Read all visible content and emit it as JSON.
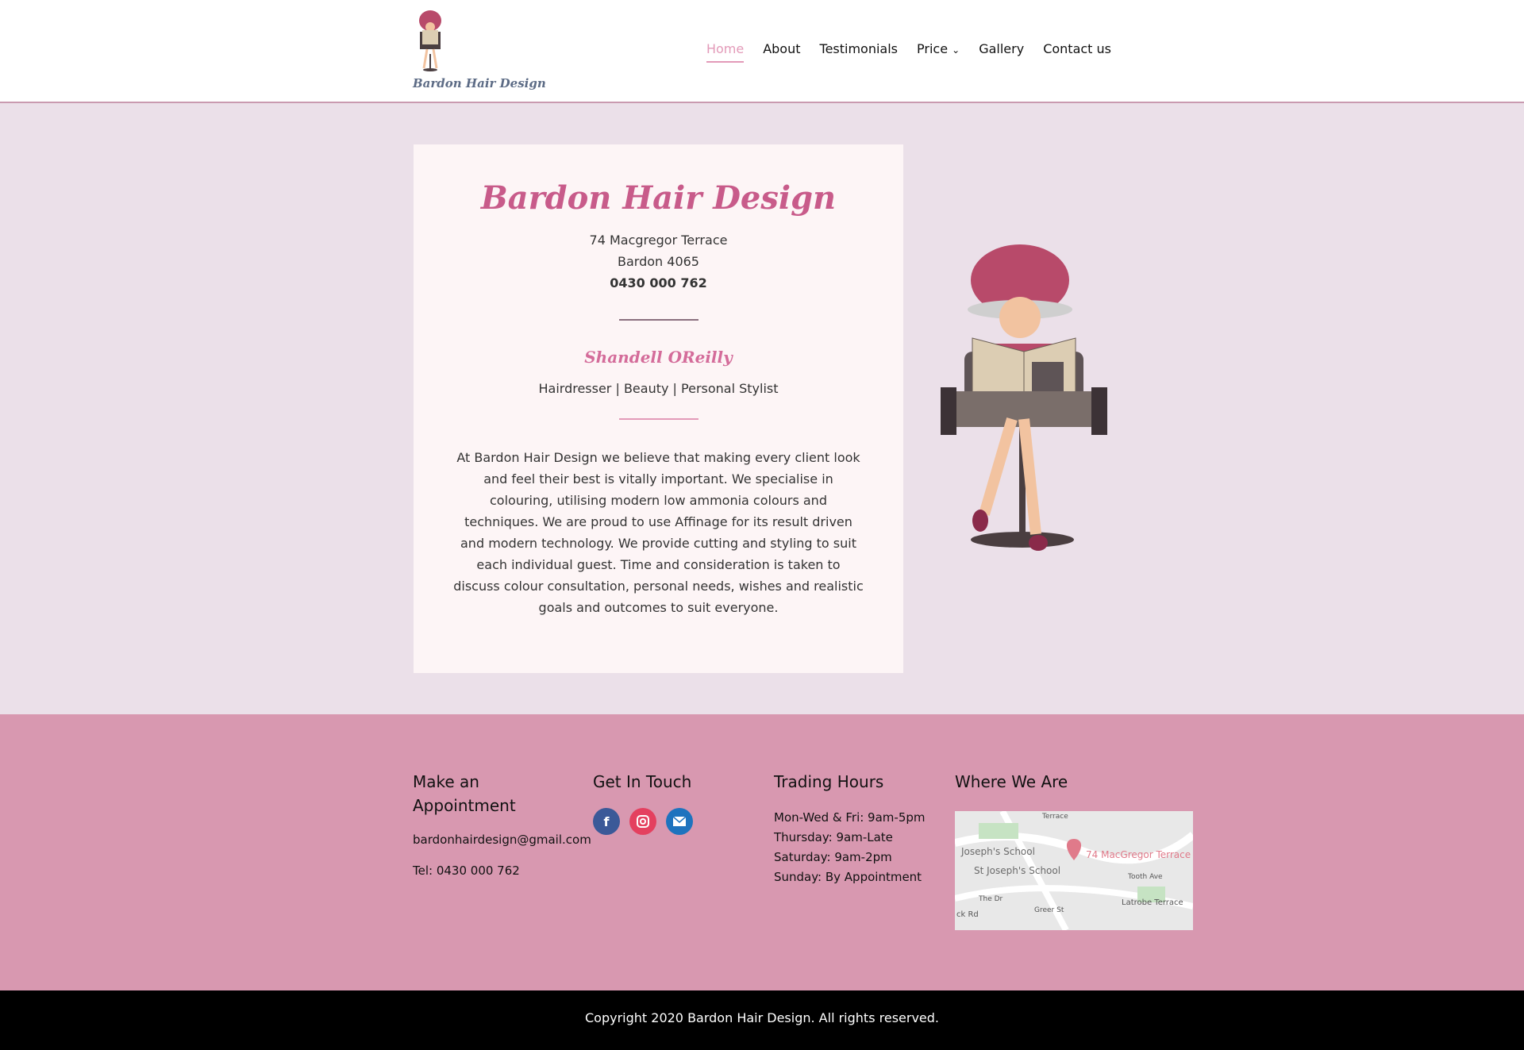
{
  "brand": {
    "logo_text": "Bardon Hair Design"
  },
  "nav": {
    "items": [
      {
        "label": "Home",
        "active": true
      },
      {
        "label": "About"
      },
      {
        "label": "Testimonials"
      },
      {
        "label": "Price"
      },
      {
        "label": "Gallery"
      },
      {
        "label": "Contact us"
      }
    ],
    "price_chevron": "⌄"
  },
  "card": {
    "title": "Bardon Hair Design",
    "address_line1": "74 Macgregor Terrace",
    "address_line2": "Bardon 4065",
    "phone": "0430 000 762",
    "person": "Shandell OReilly",
    "roles": "Hairdresser | Beauty | Personal Stylist",
    "description": "At Bardon Hair Design we believe that making every client look and feel their best is vitally important. We specialise in colouring, utilising modern low ammonia colours and techniques. We are proud to use Affinage for its result driven and modern technology. We provide cutting and styling to suit each individual guest. Time and consideration is taken to discuss colour consultation, personal needs, wishes and realistic goals and outcomes to suit everyone."
  },
  "footer": {
    "appointment": {
      "heading_line1": "Make an",
      "heading_line2": "Appointment",
      "email": "bardonhairdesign@gmail.com",
      "tel": "Tel: 0430 000 762"
    },
    "touch": {
      "heading": "Get In Touch",
      "icons": [
        "facebook-icon",
        "instagram-icon",
        "email-icon"
      ],
      "colors": {
        "facebook": "#3b5998",
        "instagram": "#e4405f",
        "email": "#1e73be"
      }
    },
    "hours": {
      "heading": "Trading Hours",
      "lines": [
        "Mon-Wed & Fri: 9am-5pm",
        "Thursday: 9am-Late",
        "Saturday: 9am-2pm",
        "Sunday: By Appointment"
      ]
    },
    "where": {
      "heading": "Where We Are",
      "map_labels": {
        "school1": "Joseph's School",
        "school2": "St Joseph's School",
        "pin_label": "74 MacGregor Terrace",
        "street1": "Latrobe Terrace",
        "street2": "Tooth Ave",
        "street3": "ck Rd",
        "street4": "Terrace",
        "street5": "Greer St",
        "street6": "The Dr"
      }
    }
  },
  "copyright": "Copyright 2020 Bardon Hair Design. All rights reserved.",
  "colors": {
    "accent_pink": "#c85b8a",
    "hero_bg": "#ebe0e9",
    "footer_bg": "#d898b0"
  }
}
